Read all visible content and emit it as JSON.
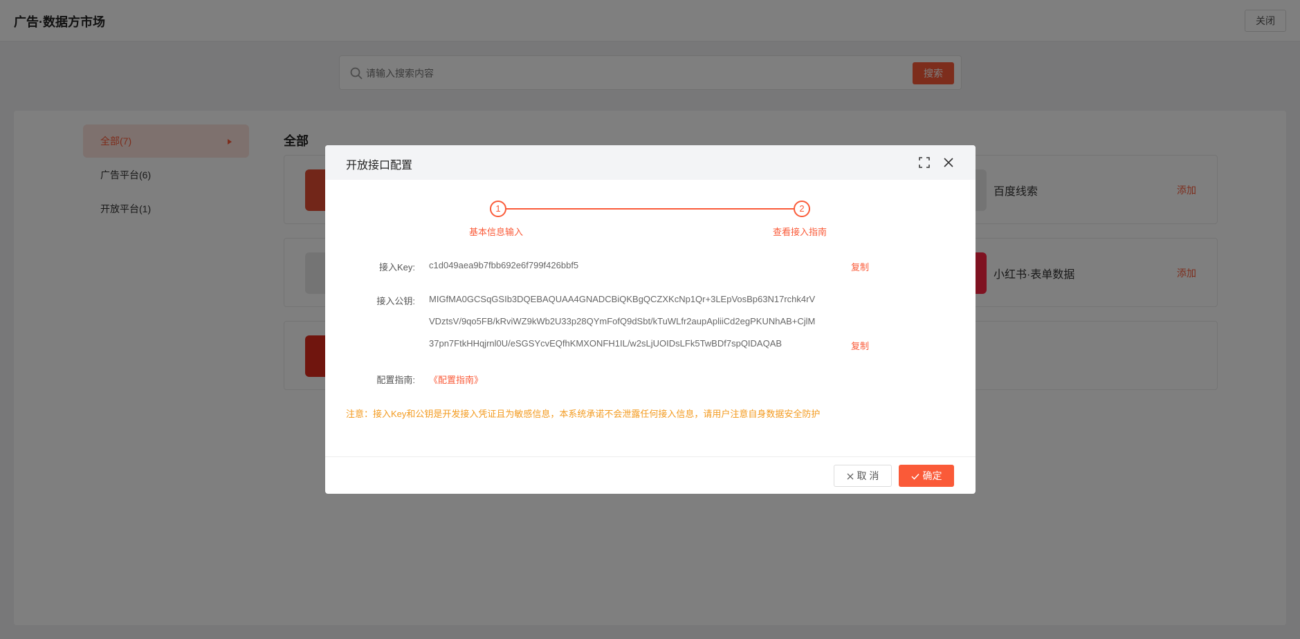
{
  "app": {
    "title": "广告·数据方市场",
    "close_label": "关闭"
  },
  "search": {
    "placeholder": "请输入搜索内容",
    "button": "搜索"
  },
  "sidebar": {
    "items": [
      {
        "label": "全部(7)"
      },
      {
        "label": "广告平台(6)"
      },
      {
        "label": "开放平台(1)"
      }
    ]
  },
  "main": {
    "section_title": "全部",
    "cards": [
      {
        "name": "百度线索",
        "action": "添加"
      },
      {
        "name": "小红书·表单数据",
        "action": "添加"
      }
    ]
  },
  "modal": {
    "title": "开放接口配置",
    "steps": [
      {
        "num": "1",
        "label": "基本信息输入"
      },
      {
        "num": "2",
        "label": "查看接入指南"
      }
    ],
    "fields": {
      "key_label": "接入Key:",
      "key_value": "c1d049aea9b7fbb692e6f799f426bbf5",
      "pubkey_label": "接入公钥:",
      "pubkey_lines": [
        "MIGfMA0GCSqGSIb3DQEBAQUAA4GNADCBiQKBgQCZXKcNp1Qr+3LEpVosBp63N17rchk4rV",
        "VDztsV/9qo5FB/kRviWZ9kWb2U33p28QYmFofQ9dSbt/kTuWLfr2aupApliiCd2egPKUNhAB+CjlM",
        "37pn7FtkHHqjrnl0U/eSGSYcvEQfhKMXONFH1IL/w2sLjUOIDsLFk5TwBDf7spQIDAQAB"
      ],
      "guide_label": "配置指南:",
      "guide_link": "《配置指南》",
      "copy_label": "复制"
    },
    "notice": "注意：接入Key和公钥是开发接入凭证且为敏感信息，本系统承诺不会泄露任何接入信息，请用户注意自身数据安全防护",
    "cancel_label": "取 消",
    "ok_label": "确定"
  },
  "colors": {
    "accent": "#fa5a38",
    "warning": "#f39a1e"
  }
}
